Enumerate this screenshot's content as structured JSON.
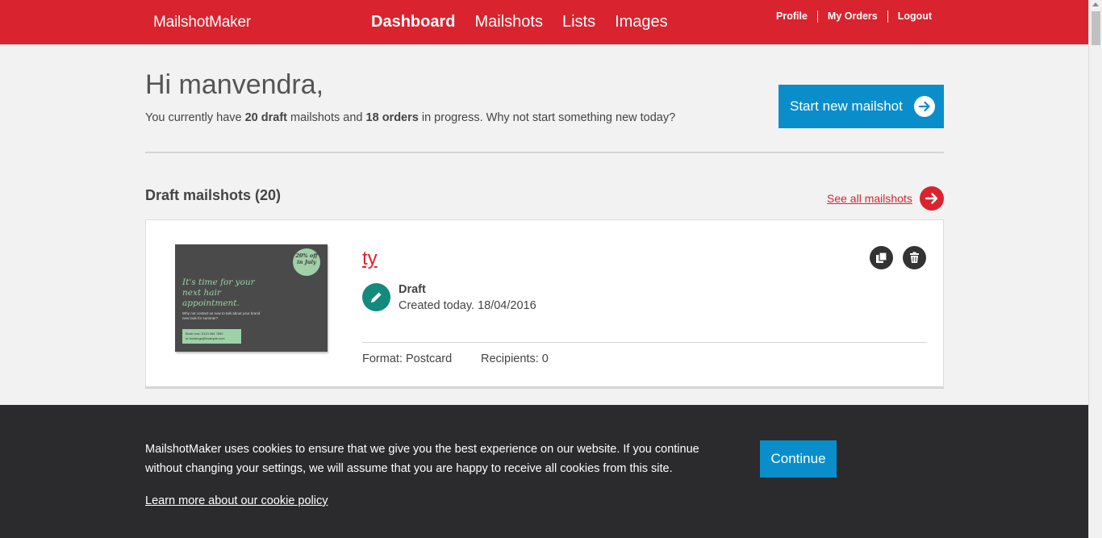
{
  "header": {
    "logo": "MailshotMaker",
    "nav": [
      {
        "label": "Dashboard"
      },
      {
        "label": "Mailshots"
      },
      {
        "label": "Lists"
      },
      {
        "label": "Images"
      }
    ],
    "user_nav": [
      {
        "label": "Profile"
      },
      {
        "label": "My Orders"
      },
      {
        "label": "Logout"
      }
    ]
  },
  "welcome": {
    "greeting": "Hi manvendra,",
    "summary_prefix": "You currently have ",
    "draft_count_text": "20 draft",
    "summary_middle": " mailshots and ",
    "order_count_text": "18 orders",
    "summary_suffix": " in progress. Why not start something new today?",
    "start_button": "Start new mailshot"
  },
  "drafts": {
    "title": "Draft mailshots (20)",
    "see_all": "See all mailshots",
    "items": [
      {
        "name": "ty",
        "status": "Draft",
        "created": "Created today. 18/04/2016",
        "format": "Format: Postcard",
        "recipients": "Recipients: 0",
        "thumbnail": {
          "badge": "20% off in July",
          "headline": "It's time for your next hair appointment.",
          "small_text": "Why not contact us now to talk about your brand new look for summer?",
          "box_line1": "Book now: 0123 456 7890",
          "box_line2": "or bookings@example.com"
        }
      }
    ]
  },
  "cookie_banner": {
    "text": "MailshotMaker uses cookies to ensure that we give you the best experience on our website. If you continue without changing your settings, we will assume that you are happy to receive all cookies from this site.",
    "link": "Learn more about our cookie policy",
    "button": "Continue"
  },
  "colors": {
    "brand_red": "#d9232e",
    "accent_blue": "#0a8ecb",
    "status_teal": "#138a7c",
    "banner_dark": "#2b2a2d"
  },
  "icons": [
    "arrow-right-icon",
    "pencil-icon",
    "copy-icon",
    "trash-icon"
  ]
}
